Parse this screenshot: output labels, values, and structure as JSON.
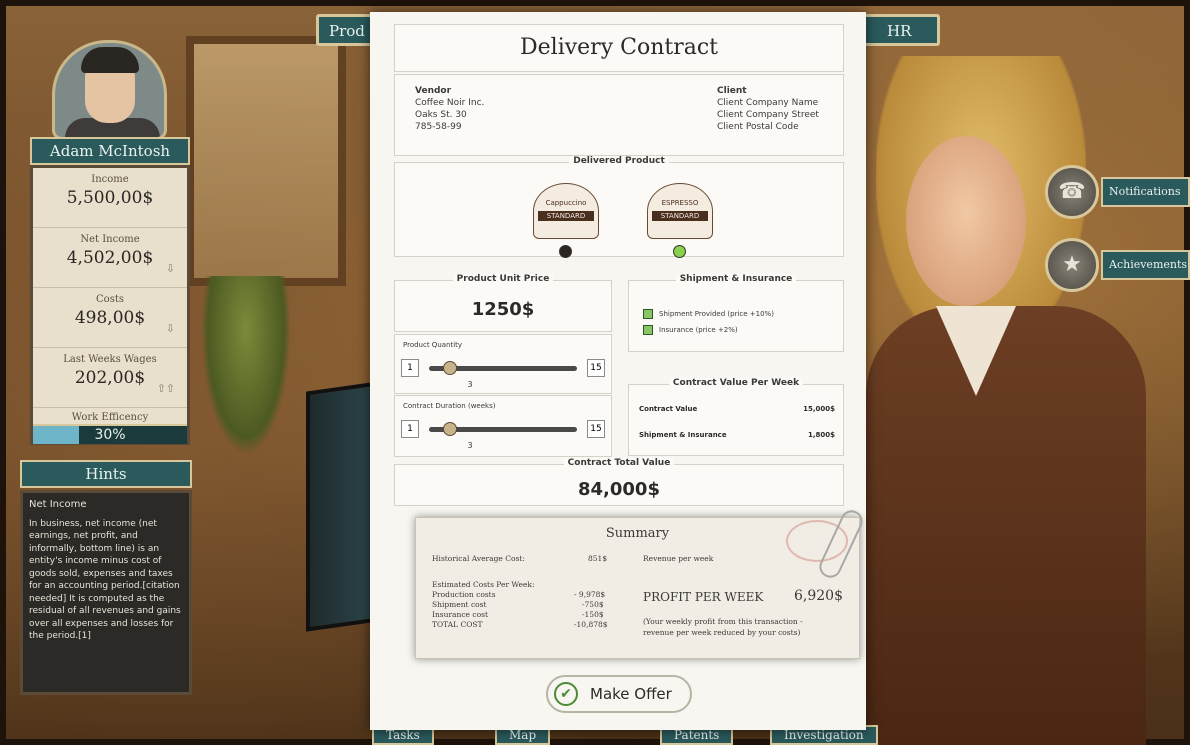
{
  "top_tabs": {
    "left": "Prod",
    "right": "HR"
  },
  "player": {
    "name": "Adam McIntosh",
    "stats": [
      {
        "label": "Income",
        "value": "5,500,00$",
        "arrow": ""
      },
      {
        "label": "Net Income",
        "value": "4,502,00$",
        "arrow": "⇩"
      },
      {
        "label": "Costs",
        "value": "498,00$",
        "arrow": "⇩"
      },
      {
        "label": "Last Weeks Wages",
        "value": "202,00$",
        "arrow": "⇧⇧"
      }
    ],
    "efficiency": {
      "label": "Work Efficency",
      "value": "30%",
      "percent": 30
    }
  },
  "hints": {
    "header": "Hints",
    "title": "Net Income",
    "body": "In business, net income (net earnings, net profit, and informally, bottom line) is an entity's income minus cost of goods sold, expenses and taxes for an accounting period.[citation needed] It is computed as the residual of all revenues and gains over all expenses and losses for the period.[1]"
  },
  "side_buttons": {
    "notifications": "Notifications",
    "achievements": "Achievements"
  },
  "bottom_tabs": [
    "Tasks",
    "Map",
    "Patents",
    "Investigation"
  ],
  "contract": {
    "title": "Delivery Contract",
    "vendor": {
      "label": "Vendor",
      "name": "Coffee Noir Inc.",
      "street": "Oaks St. 30",
      "phone": "785-58-99"
    },
    "client": {
      "label": "Client",
      "name": "Client Company Name",
      "street": "Client Company Street",
      "postal": "Client Postal Code"
    },
    "delivered_product": {
      "label": "Delivered Product",
      "products": [
        {
          "name": "Cappuccino",
          "tier": "STANDARD",
          "selected": false,
          "radio_color": "#2b2622"
        },
        {
          "name": "ESPRESSO",
          "tier": "STANDARD",
          "selected": true,
          "radio_color": "#8ad04a"
        }
      ]
    },
    "unit_price": {
      "label": "Product Unit Price",
      "value": "1250$"
    },
    "quantity": {
      "label": "Product Quantity",
      "min": "1",
      "max": "15",
      "value": "3",
      "fraction": 0.143
    },
    "duration": {
      "label": "Contract Duration (weeks)",
      "min": "1",
      "max": "15",
      "value": "3",
      "fraction": 0.143
    },
    "shipment": {
      "label": "Shipment & Insurance",
      "options": [
        "Shipment Provided (price +10%)",
        "Insurance (price +2%)"
      ]
    },
    "value_per_week": {
      "label": "Contract Value Per Week",
      "rows": [
        {
          "label": "Contract Value",
          "value": "15,000$"
        },
        {
          "label": "Shipment & Insurance",
          "value": "1,800$"
        }
      ]
    },
    "total": {
      "label": "Contract Total Value",
      "value": "84,000$"
    }
  },
  "summary": {
    "title": "Summary",
    "avg_cost_label": "Historical Average Cost:",
    "avg_cost_value": "851$",
    "revenue_label": "Revenue per week",
    "costs_header": "Estimated Costs Per Week:",
    "costs": [
      {
        "label": "Production costs",
        "value": "- 9,978$"
      },
      {
        "label": "Shipment cost",
        "value": "-750$"
      },
      {
        "label": "Insurance cost",
        "value": "-150$"
      },
      {
        "label": "TOTAL COST",
        "value": "-10,878$"
      }
    ],
    "profit_label": "PROFIT PER WEEK",
    "profit_value": "6,920$",
    "profit_note_1": "(Your weekly profit from this transaction -",
    "profit_note_2": "revenue per week reduced by your costs)"
  },
  "make_offer": "Make Offer"
}
